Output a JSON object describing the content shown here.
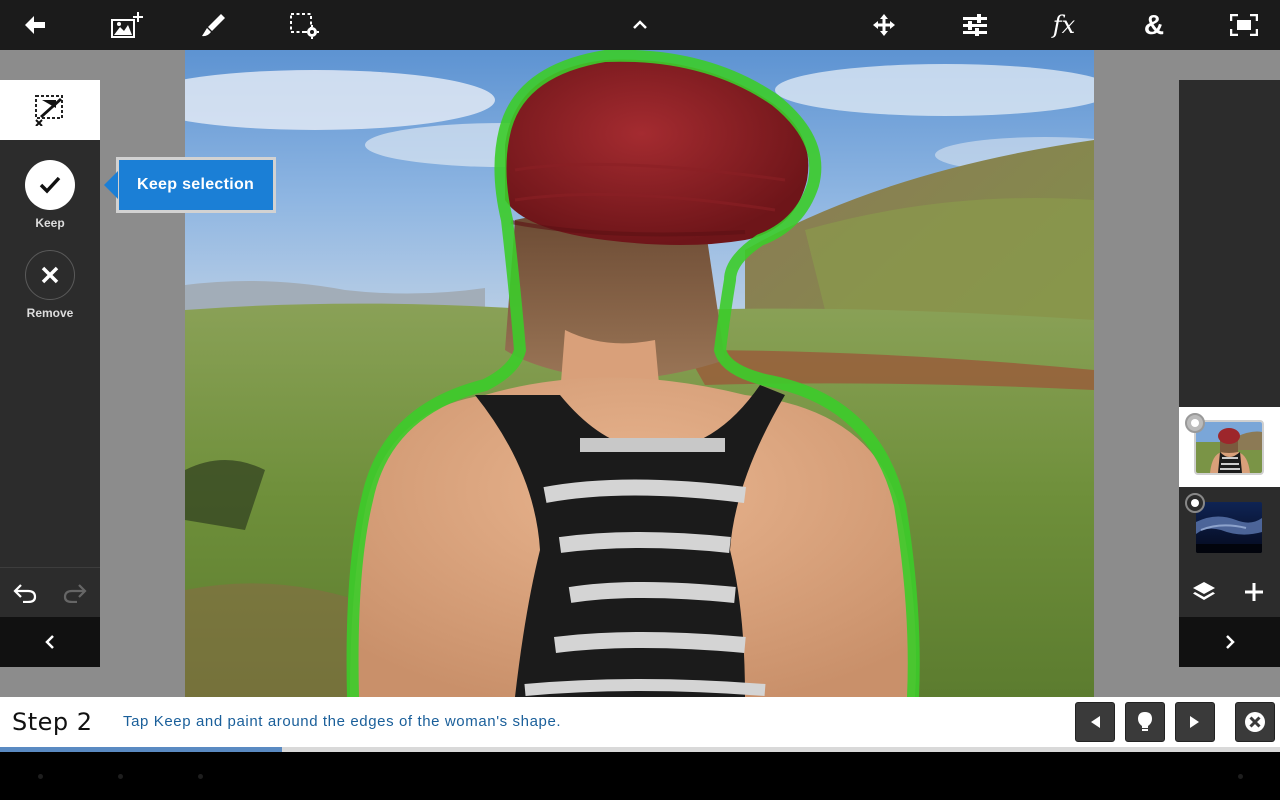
{
  "toolbar": {
    "items": [
      {
        "icon": "back-arrow-icon"
      },
      {
        "icon": "add-image-icon"
      },
      {
        "icon": "brush-icon"
      },
      {
        "icon": "selection-settings-icon"
      },
      {
        "icon": "chevron-up-icon"
      },
      {
        "icon": "move-icon"
      },
      {
        "icon": "adjustments-icon"
      },
      {
        "icon": "effects-icon",
        "label": "fx"
      },
      {
        "icon": "blend-icon",
        "label": "&"
      },
      {
        "icon": "fit-screen-icon"
      }
    ]
  },
  "left_panel": {
    "header_icon": "refine-selection-icon",
    "tools": [
      {
        "label": "Keep",
        "icon": "check-icon",
        "active": true
      },
      {
        "label": "Remove",
        "icon": "close-icon",
        "active": false
      }
    ],
    "undo_icon": "undo-icon",
    "redo_icon": "redo-icon",
    "collapse_icon": "chevron-left-icon"
  },
  "tooltip": {
    "text": "Keep selection"
  },
  "right_panel": {
    "layers": [
      {
        "name": "woman-photo",
        "active": true
      },
      {
        "name": "night-sky",
        "active": false
      }
    ],
    "layers_icon": "layers-icon",
    "add_icon": "plus-icon",
    "expand_icon": "chevron-right-icon"
  },
  "step_bar": {
    "title": "Step 2",
    "instruction": "Tap Keep and paint around the edges of the woman's shape.",
    "progress": 0.22,
    "buttons": [
      "previous-icon",
      "hint-icon",
      "next-icon",
      "close-tutorial-icon"
    ]
  },
  "colors": {
    "accent": "#1b7fd6",
    "selection": "#3ccc2a",
    "toolbar": "#1b1b1b",
    "panel": "#2c2c2c",
    "step_text": "#1a5f9a"
  }
}
